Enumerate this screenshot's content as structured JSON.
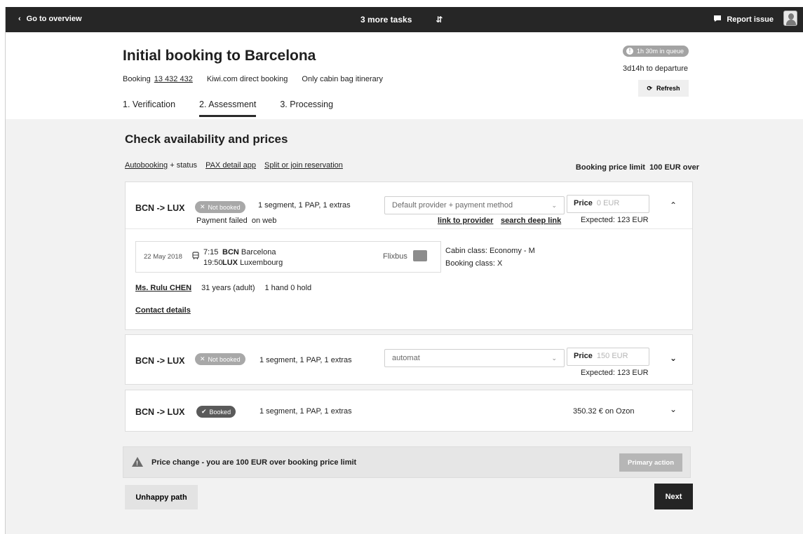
{
  "topbar": {
    "back_label": "Go to overview",
    "tasks_label": "3 more tasks",
    "report_label": "Report issue"
  },
  "header": {
    "title": "Initial booking to Barcelona",
    "booking_prefix": "Booking",
    "booking_number": "13 432 432",
    "booking_type": "Kiwi.com direct booking",
    "itinerary_note": "Only cabin bag itinerary",
    "queue_badge": "1h 30m in queue",
    "departure": "3d14h to departure",
    "refresh_label": "Refresh",
    "tabs": [
      {
        "label": "1. Verification",
        "active": false
      },
      {
        "label": "2. Assessment",
        "active": true
      },
      {
        "label": "3. Processing",
        "active": false
      }
    ]
  },
  "main": {
    "heading": "Check availability and prices",
    "links": {
      "autobooking": "Autobooking",
      "status": "+ status",
      "pax_app": "PAX detail app",
      "split_join": "Split or join reservation"
    },
    "price_limit_label": "Booking price limit",
    "price_limit_value": "100 EUR over"
  },
  "cards": [
    {
      "route": "BCN -> LUX",
      "status": "Not booked",
      "summary": "1 segment, 1 PAP, 1 extras",
      "error": "Payment failed",
      "error_context": "on web",
      "provider": "Default provider + payment method",
      "price_label": "Price",
      "price_value": "0 EUR",
      "expected": "Expected: 123 EUR",
      "link_provider": "link to provider",
      "link_deep": "search deep link",
      "segment": {
        "date": "22 May 2018",
        "dep_time": "7:15",
        "arr_time": "19:50",
        "dep_code": "BCN",
        "dep_city": "Barcelona",
        "arr_code": "LUX",
        "arr_city": "Luxembourg",
        "carrier": "Flixbus",
        "cabin_class": "Cabin class: Economy - M",
        "booking_class": "Booking class: X"
      },
      "passenger": {
        "name": "Ms. Rulu CHEN",
        "age": "31 years (adult)",
        "bags": "1 hand 0 hold"
      },
      "contact_label": "Contact details"
    },
    {
      "route": "BCN -> LUX",
      "status": "Not booked",
      "summary": "1 segment, 1 PAP, 1 extras",
      "provider": "automat",
      "price_label": "Price",
      "price_value": "150 EUR",
      "expected": "Expected: 123 EUR"
    },
    {
      "route": "BCN -> LUX",
      "status": "Booked",
      "summary": "1 segment, 1 PAP, 1 extras",
      "booked_price": "350.32 € on Ozon"
    }
  ],
  "alert": {
    "message": "Price change - you are 100 EUR over booking price limit",
    "primary_label": "Primary action"
  },
  "footer": {
    "unhappy_label": "Unhappy path",
    "next_label": "Next"
  },
  "colors": {
    "topbar": "#262626",
    "background": "#f2f2f2",
    "pill": "#a8a8a8",
    "booked_pill": "#5a5a5a"
  }
}
